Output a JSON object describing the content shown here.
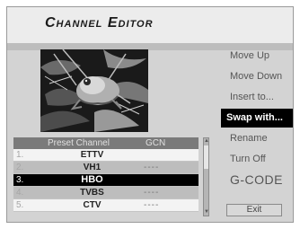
{
  "header": {
    "title": "Channel Editor"
  },
  "table": {
    "headers": {
      "preset": "Preset Channel",
      "gcn": "GCN"
    },
    "rows": [
      {
        "num": "1.",
        "name": "ETTV",
        "gcn": ""
      },
      {
        "num": "2.",
        "name": "VH1",
        "gcn": "----"
      },
      {
        "num": "3.",
        "name": "HBO",
        "gcn": ""
      },
      {
        "num": "4.",
        "name": "TVBS",
        "gcn": "----"
      },
      {
        "num": "5.",
        "name": "CTV",
        "gcn": "----"
      }
    ],
    "selected_index": 2
  },
  "menu": {
    "items": [
      "Move Up",
      "Move Down",
      "Insert to...",
      "Swap with...",
      "Rename",
      "Turn Off",
      "G-CODE"
    ],
    "selected_index": 3,
    "exit_label": "Exit"
  },
  "colors": {
    "background": "#d3d3d3",
    "title_bar": "#ececec",
    "selected": "#000000",
    "header": "#7a7a7a"
  },
  "icons": [
    "scroll-up-arrow-icon",
    "scroll-down-arrow-icon"
  ]
}
